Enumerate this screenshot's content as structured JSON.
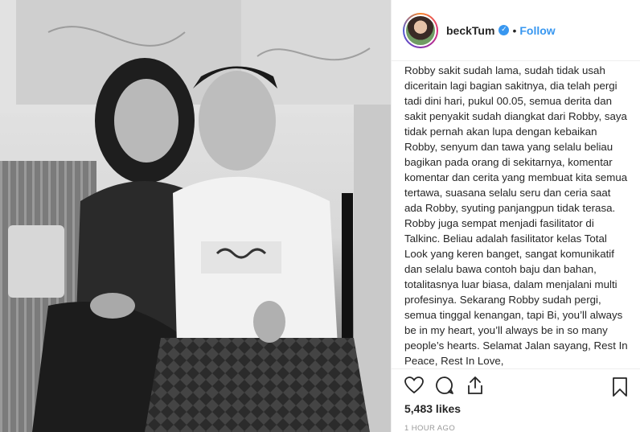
{
  "post": {
    "photo_alt_name": "post-photo"
  },
  "header": {
    "username": "beckTum",
    "verified_glyph": "✓",
    "separator": "•",
    "follow_label": "Follow"
  },
  "caption": {
    "text": "Robby sakit sudah lama, sudah tidak usah diceritain lagi bagian sakitnya, dia telah pergi tadi dini hari, pukul 00.05, semua derita dan sakit penyakit sudah diangkat dari Robby, saya tidak pernah akan lupa dengan kebaikan Robby, senyum dan tawa yang selalu beliau bagikan pada orang di sekitarnya, komentar komentar dan cerita yang membuat kita semua tertawa, suasana selalu seru dan ceria saat ada Robby, syuting panjangpun tidak terasa. Robby juga sempat menjadi fasilitator di Talkinc. Beliau adalah fasilitator kelas Total Look yang keren banget, sangat komunikatif dan selalu bawa contoh baju dan bahan, totalitasnya luar biasa, dalam menjalani multi profesinya. Sekarang Robby sudah pergi, semua tinggal kenangan, tapi Bi, you’ll always be in my heart, you’ll always be in so many people’s hearts. Selamat Jalan sayang, Rest In Peace, Rest In Love,"
  },
  "actions": {
    "like_icon": "heart-icon",
    "comment_icon": "comment-icon",
    "share_icon": "share-icon",
    "save_icon": "bookmark-icon"
  },
  "likes": "5,483 likes",
  "timestamp": "1 HOUR AGO",
  "colors": {
    "link_blue": "#3897f0",
    "text": "#262626",
    "muted": "#999999",
    "divider": "#efefef"
  }
}
